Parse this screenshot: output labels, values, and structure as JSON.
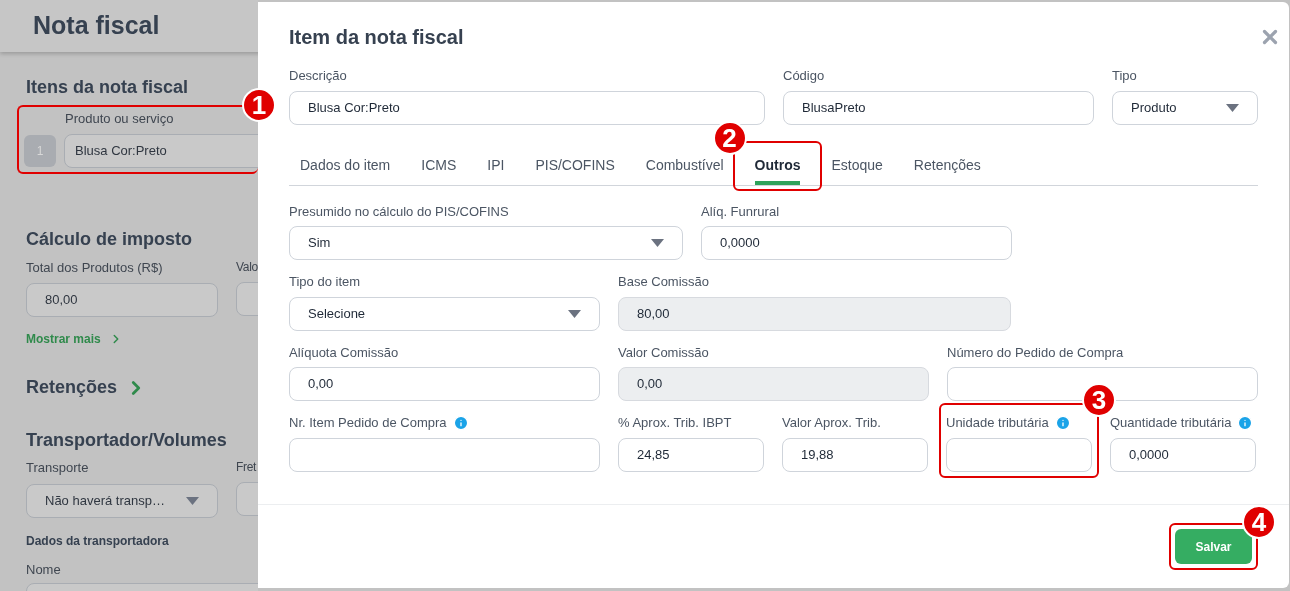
{
  "page": {
    "title": "Nota fiscal",
    "items_section": {
      "title": "Itens da nota fiscal",
      "field_label": "Produto ou serviço",
      "index": "1",
      "value": "Blusa Cor:Preto",
      "marker": "1"
    },
    "tax_section": {
      "title": "Cálculo de imposto",
      "labels": [
        "Total dos Produtos (R$)",
        "Valo"
      ],
      "value": "80,00",
      "more_link": "Mostrar mais"
    },
    "retentions": {
      "title": "Retenções"
    },
    "transport_section": {
      "title": "Transportador/Volumes",
      "labels": [
        "Transporte",
        "Fret"
      ],
      "value": "Não haverá transp…",
      "subtitle": "Dados da transportadora",
      "name_label": "Nome"
    }
  },
  "modal": {
    "title": "Item da nota fiscal",
    "top_fields": [
      {
        "label": "Descrição",
        "kind": "text",
        "value": "Blusa Cor:Preto",
        "info": false
      },
      {
        "label": "Código",
        "kind": "text",
        "value": "BlusaPreto",
        "info": false
      },
      {
        "label": "Tipo",
        "kind": "select",
        "value": "Produto",
        "info": false
      }
    ],
    "tabs": [
      {
        "label": "Dados do item",
        "selected": false
      },
      {
        "label": "ICMS",
        "selected": false
      },
      {
        "label": "IPI",
        "selected": false
      },
      {
        "label": "PIS/COFINS",
        "selected": false
      },
      {
        "label": "Combustível",
        "selected": false
      },
      {
        "label": "Outros",
        "selected": true,
        "marker": "2"
      },
      {
        "label": "Estoque",
        "selected": false
      },
      {
        "label": "Retenções",
        "selected": false
      }
    ],
    "fields": [
      {
        "label": "Presumido no cálculo do PIS/COFINS",
        "kind": "select",
        "value": "Sim",
        "info": false
      },
      {
        "label": "Alíq. Funrural",
        "kind": "text",
        "value": "0,0000",
        "info": false
      },
      {
        "label": "Tipo do item",
        "kind": "select",
        "value": "Selecione",
        "info": false
      },
      {
        "label": "Base Comissão",
        "kind": "readonly",
        "value": "80,00",
        "info": false
      },
      {
        "label": "Alíquota Comissão",
        "kind": "text",
        "value": "0,00",
        "info": false
      },
      {
        "label": "Valor Comissão",
        "kind": "readonly",
        "value": "0,00",
        "info": false
      },
      {
        "label": "Número do Pedido de Compra",
        "kind": "text",
        "info": false
      },
      {
        "label": "Nr. Item Pedido de Compra",
        "kind": "text",
        "info": true
      },
      {
        "label": "% Aprox. Trib. IBPT",
        "kind": "text",
        "value": "24,85",
        "info": false
      },
      {
        "label": "Valor Aprox. Trib.",
        "kind": "text",
        "value": "19,88",
        "info": false
      },
      {
        "label": "Unidade tributária",
        "kind": "text",
        "info": true,
        "marker": "3"
      },
      {
        "label": "Quantidade tributária",
        "kind": "text",
        "value": "0,0000",
        "info": true
      }
    ],
    "save_button": {
      "label": "Salvar",
      "marker": "4"
    }
  }
}
